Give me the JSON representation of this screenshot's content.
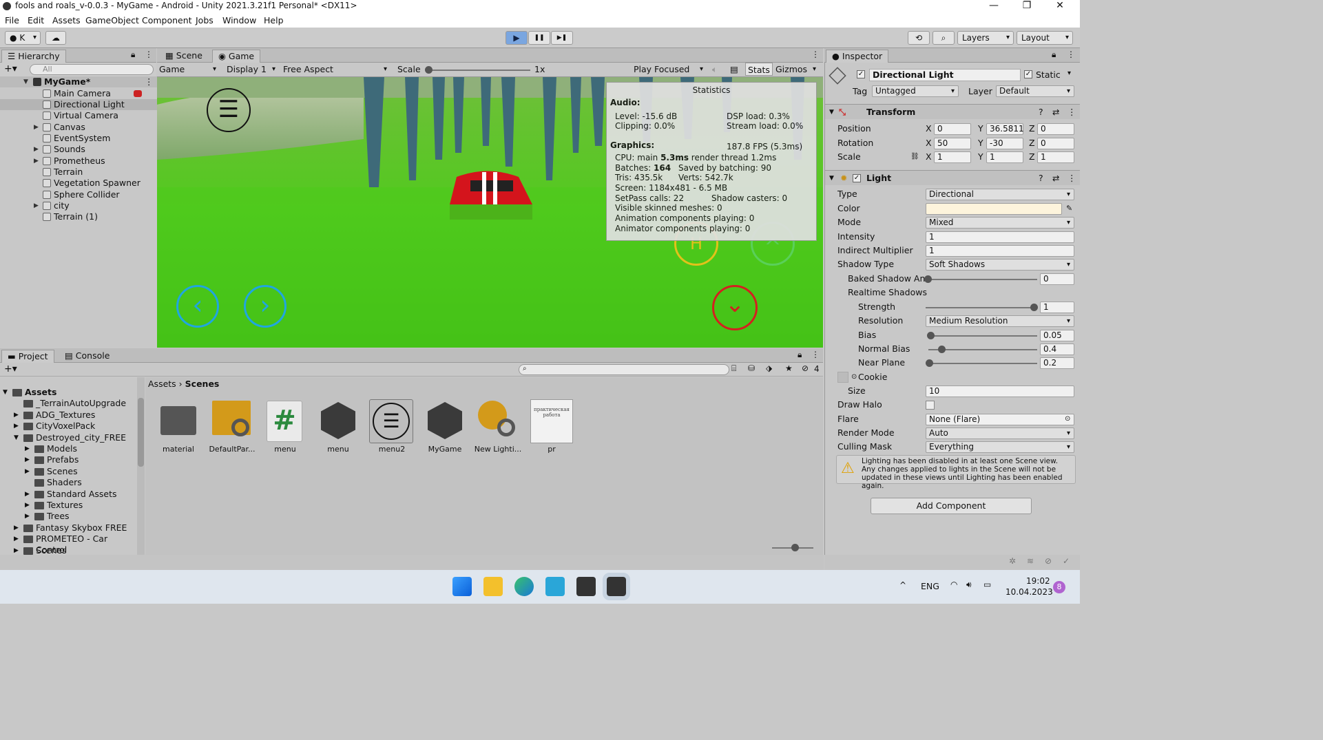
{
  "window": {
    "title": "fools and roals_v-0.0.3 - MyGame - Android - Unity 2021.3.21f1 Personal* <DX11>",
    "minimize": "—",
    "restore": "❐",
    "close": "✕"
  },
  "menu": [
    "File",
    "Edit",
    "Assets",
    "GameObject",
    "Component",
    "Jobs",
    "Window",
    "Help"
  ],
  "toolbar": {
    "account": "K",
    "layers": "Layers",
    "layout": "Layout",
    "play": "▶",
    "pause": "❚❚",
    "step": "▶❚"
  },
  "hierarchy": {
    "tab": "Hierarchy",
    "search_placeholder": "All",
    "scene": "MyGame*",
    "items": [
      "Main Camera",
      "Directional Light",
      "Virtual Camera",
      "Canvas",
      "EventSystem",
      "Sounds",
      "Prometheus",
      "Terrain",
      "Vegetation Spawner",
      "Sphere Collider",
      "city",
      "Terrain (1)"
    ]
  },
  "game": {
    "tab_scene": "Scene",
    "tab_game": "Game",
    "mode": "Game",
    "display": "Display 1",
    "aspect": "Free Aspect",
    "scale_label": "Scale",
    "scale_value": "1x",
    "play_focused": "Play Focused",
    "stats": "Stats",
    "gizmos": "Gizmos",
    "btn_h": "H",
    "btn_left": "‹",
    "btn_right": "›",
    "btn_down": "⌄",
    "btn_up": "^"
  },
  "stats": {
    "title": "Statistics",
    "audio": "Audio:",
    "level": "Level: -15.6 dB",
    "clipping": "Clipping: 0.0%",
    "dsp": "DSP load: 0.3%",
    "stream": "Stream load: 0.0%",
    "graphics": "Graphics:",
    "fps": "187.8 FPS (5.3ms)",
    "cpu_pre": "CPU: main ",
    "cpu_main": "5.3ms",
    "cpu_post": "  render thread 1.2ms",
    "batches_pre": "Batches: ",
    "batches": "164",
    "saved": "Saved by batching: 90",
    "tris": "Tris: 435.5k",
    "verts": "Verts: 542.7k",
    "screen": "Screen: 1184x481 - 6.5 MB",
    "setpass": "SetPass calls: 22",
    "shadow": "Shadow casters: 0",
    "skinned": "Visible skinned meshes: 0",
    "anim": "Animation components playing: 0",
    "animator": "Animator components playing: 0"
  },
  "project": {
    "tab_project": "Project",
    "tab_console": "Console",
    "breadcrumb_root": "Assets",
    "breadcrumb_leaf": "Scenes",
    "hidden_count": "4",
    "tree": [
      {
        "label": "Assets",
        "level": 0,
        "arrow": "▼",
        "bold": true
      },
      {
        "label": "_TerrainAutoUpgrade",
        "level": 1,
        "arrow": ""
      },
      {
        "label": "ADG_Textures",
        "level": 1,
        "arrow": "▶"
      },
      {
        "label": "CityVoxelPack",
        "level": 1,
        "arrow": "▶"
      },
      {
        "label": "Destroyed_city_FREE",
        "level": 1,
        "arrow": "▼"
      },
      {
        "label": "Models",
        "level": 2,
        "arrow": "▶"
      },
      {
        "label": "Prefabs",
        "level": 2,
        "arrow": "▶"
      },
      {
        "label": "Scenes",
        "level": 2,
        "arrow": "▶"
      },
      {
        "label": "Shaders",
        "level": 2,
        "arrow": ""
      },
      {
        "label": "Standard Assets",
        "level": 2,
        "arrow": "▶"
      },
      {
        "label": "Textures",
        "level": 2,
        "arrow": "▶"
      },
      {
        "label": "Trees",
        "level": 2,
        "arrow": "▶"
      },
      {
        "label": "Fantasy Skybox FREE",
        "level": 1,
        "arrow": "▶"
      },
      {
        "label": "PROMETEO - Car Control",
        "level": 1,
        "arrow": "▶"
      },
      {
        "label": "Scenes",
        "level": 1,
        "arrow": "▶"
      }
    ],
    "assets": [
      "material",
      "DefaultPar...",
      "menu",
      "menu",
      "menu2",
      "MyGame",
      "New Lighti...",
      "pr"
    ],
    "pr_thumb_text": "практическая работа"
  },
  "inspector": {
    "tab": "Inspector",
    "object_name": "Directional Light",
    "static": "Static",
    "tag_label": "Tag",
    "tag": "Untagged",
    "layer_label": "Layer",
    "layer": "Default",
    "transform": "Transform",
    "position": "Position",
    "rotation": "Rotation",
    "scale": "Scale",
    "px": "0",
    "py": "36.5811",
    "pz": "0",
    "rx": "50",
    "ry": "-30",
    "rz": "0",
    "sx": "1",
    "sy": "1",
    "sz": "1",
    "x": "X",
    "y": "Y",
    "z": "Z",
    "light": "Light",
    "type_l": "Type",
    "type": "Directional",
    "color_l": "Color",
    "color": "#fdf4dc",
    "mode_l": "Mode",
    "mode": "Mixed",
    "intensity_l": "Intensity",
    "intensity": "1",
    "indirect_l": "Indirect Multiplier",
    "indirect": "1",
    "shadow_l": "Shadow Type",
    "shadow": "Soft Shadows",
    "baked_l": "Baked Shadow An",
    "baked": "0",
    "realtime_l": "Realtime Shadows",
    "strength_l": "Strength",
    "strength": "1",
    "resolution_l": "Resolution",
    "resolution": "Medium Resolution",
    "bias_l": "Bias",
    "bias": "0.05",
    "nbias_l": "Normal Bias",
    "nbias": "0.4",
    "near_l": "Near Plane",
    "near": "0.2",
    "cookie_l": "Cookie",
    "size_l": "Size",
    "size": "10",
    "halo_l": "Draw Halo",
    "flare_l": "Flare",
    "flare": "None (Flare)",
    "render_l": "Render Mode",
    "render": "Auto",
    "cull_l": "Culling Mask",
    "cull": "Everything",
    "warning": "Lighting has been disabled in at least one Scene view. Any changes applied to lights in the Scene will not be updated in these views until Lighting has been enabled again.",
    "add_component": "Add Component"
  },
  "taskbar": {
    "lang": "ENG",
    "time": "19:02",
    "date": "10.04.2023",
    "badge": "8"
  }
}
